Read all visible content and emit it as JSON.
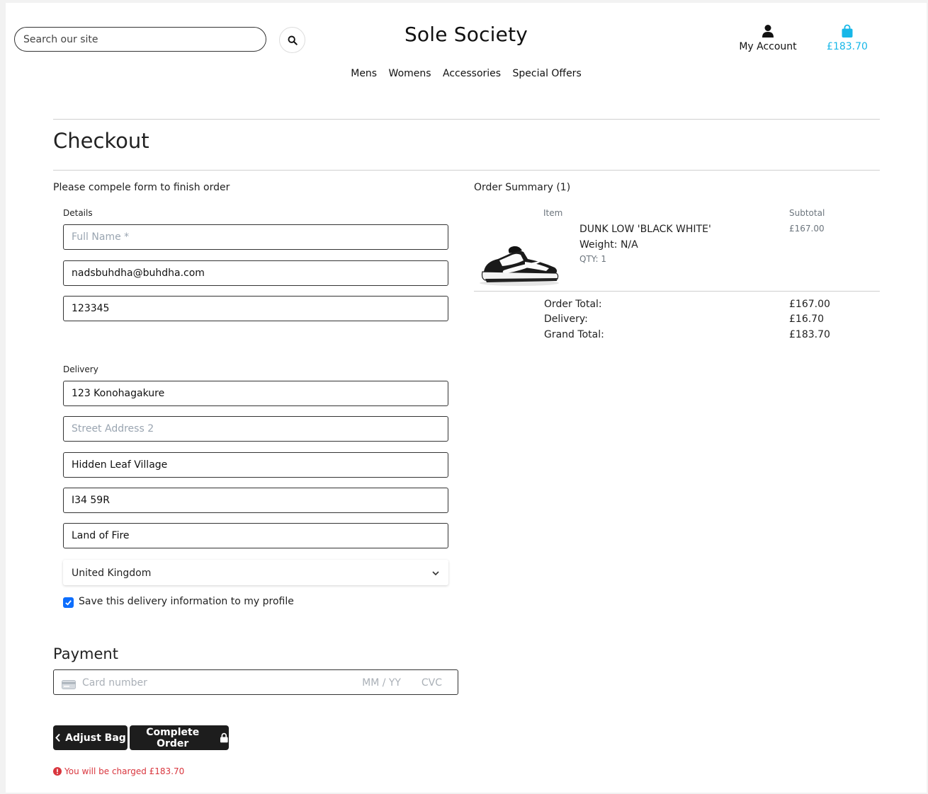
{
  "header": {
    "search_placeholder": "Search our site",
    "brand": "Sole Society",
    "account_label": "My Account",
    "bag_total": "£183.70",
    "accent_color": "#17b7e8"
  },
  "nav": {
    "items": [
      "Mens",
      "Womens",
      "Accessories",
      "Special Offers"
    ]
  },
  "checkout": {
    "title": "Checkout",
    "intro": "Please compele form to finish order",
    "details_label": "Details",
    "full_name": {
      "value": "",
      "placeholder": "Full Name *"
    },
    "email": {
      "value": "nadsbuhdha@buhdha.com",
      "placeholder": ""
    },
    "phone": {
      "value": "123345",
      "placeholder": ""
    },
    "delivery_label": "Delivery",
    "street1": {
      "value": "123 Konohagakure",
      "placeholder": ""
    },
    "street2": {
      "value": "",
      "placeholder": "Street Address 2"
    },
    "town": {
      "value": "Hidden Leaf Village",
      "placeholder": ""
    },
    "postcode": {
      "value": "I34 59R",
      "placeholder": ""
    },
    "county": {
      "value": "Land of Fire",
      "placeholder": ""
    },
    "country": "United Kingdom",
    "save_info_label": "Save this delivery information to my profile",
    "save_info_checked": true
  },
  "payment": {
    "title": "Payment",
    "card_placeholder": "Card number",
    "expiry_placeholder": "MM / YY",
    "cvc_placeholder": "CVC"
  },
  "actions": {
    "adjust_bag": "Adjust Bag",
    "complete_order": "Complete Order",
    "charge_notice": "You will be charged £183.70"
  },
  "summary": {
    "title": "Order Summary (1)",
    "item_header": "Item",
    "subtotal_header": "Subtotal",
    "items": [
      {
        "name": "DUNK LOW 'BLACK WHITE'",
        "weight": "Weight: N/A",
        "qty": "QTY: 1",
        "subtotal": "£167.00"
      }
    ],
    "order_total_label": "Order Total:",
    "order_total": "£167.00",
    "delivery_label": "Delivery:",
    "delivery": "£16.70",
    "grand_total_label": "Grand Total:",
    "grand_total": "£183.70"
  },
  "icons": {
    "search": "search-icon",
    "account": "user-icon",
    "bag": "shopping-bag-icon",
    "chevron": "chevron-down-icon",
    "check": "check-icon",
    "card": "credit-card-icon",
    "back": "chevron-left-icon",
    "lock": "lock-icon",
    "alert": "exclamation-circle-icon"
  },
  "colors": {
    "error": "#d9363e",
    "checkbox": "#0d6efd",
    "button": "#1d1d1d"
  }
}
